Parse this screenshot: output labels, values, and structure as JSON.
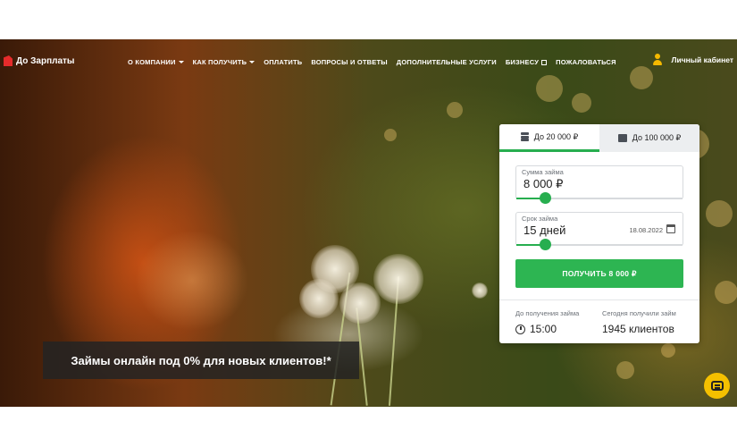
{
  "brand": {
    "name": "До Зарплаты",
    "accent_color": "#2db552",
    "logo_color": "#e52b2b"
  },
  "nav": {
    "items": [
      {
        "label": "О КОМПАНИИ",
        "dropdown": true
      },
      {
        "label": "КАК ПОЛУЧИТЬ",
        "dropdown": true
      },
      {
        "label": "ОПЛАТИТЬ",
        "dropdown": false
      },
      {
        "label": "ВОПРОСЫ И ОТВЕТЫ",
        "dropdown": false
      },
      {
        "label": "ДОПОЛНИТЕЛЬНЫЕ УСЛУГИ",
        "dropdown": false
      },
      {
        "label": "БИЗНЕСУ",
        "external": true
      },
      {
        "label": "ПОЖАЛОВАТЬСЯ",
        "dropdown": false
      }
    ],
    "cabinet_label": "Личный кабинет"
  },
  "calculator": {
    "tabs": [
      {
        "label": "До 20 000 ₽",
        "active": true,
        "icon": "coins-icon"
      },
      {
        "label": "До 100 000 ₽",
        "active": false,
        "icon": "briefcase-icon"
      }
    ],
    "amount": {
      "label": "Сумма займа",
      "value": "8 000 ₽",
      "slider_fraction": 0.17
    },
    "term": {
      "label": "Срок займа",
      "value": "15 дней",
      "date": "18.08.2022",
      "slider_fraction": 0.17
    },
    "cta_label": "ПОЛУЧИТЬ 8 000 ₽",
    "stats": {
      "time_label": "До получения займа",
      "time_value": "15:00",
      "clients_label": "Сегодня получили займ",
      "clients_value": "1945 клиентов"
    }
  },
  "promo": {
    "text": "Займы онлайн под 0% для новых клиентов!*"
  },
  "chat": {
    "icon": "chat-icon"
  }
}
